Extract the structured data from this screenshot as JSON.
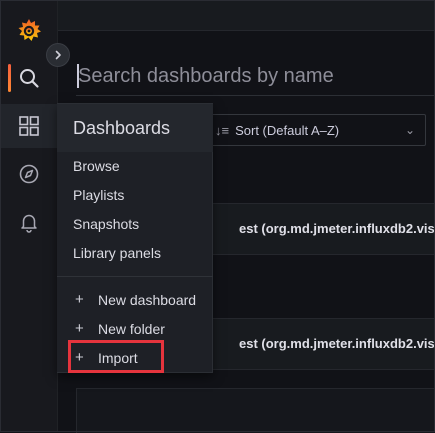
{
  "search": {
    "placeholder": "Search dashboards by name",
    "value": ""
  },
  "sort": {
    "label": "Sort (Default A–Z)",
    "icon": "sort-lines-icon"
  },
  "results": [
    {
      "title": "est (org.md.jmeter.influxdb2.visua"
    },
    {
      "title": "est (org.md.jmeter.influxdb2.visua"
    }
  ],
  "menu": {
    "title": "Dashboards",
    "items": [
      {
        "label": "Browse"
      },
      {
        "label": "Playlists"
      },
      {
        "label": "Snapshots"
      },
      {
        "label": "Library panels"
      }
    ],
    "actions": [
      {
        "label": "New dashboard",
        "icon": "plus-icon"
      },
      {
        "label": "New folder",
        "icon": "plus-icon"
      },
      {
        "label": "Import",
        "icon": "plus-icon"
      }
    ]
  },
  "colors": {
    "accent_orange": "#f55f3e",
    "highlight_red": "#e5343d",
    "background": "#111217"
  }
}
